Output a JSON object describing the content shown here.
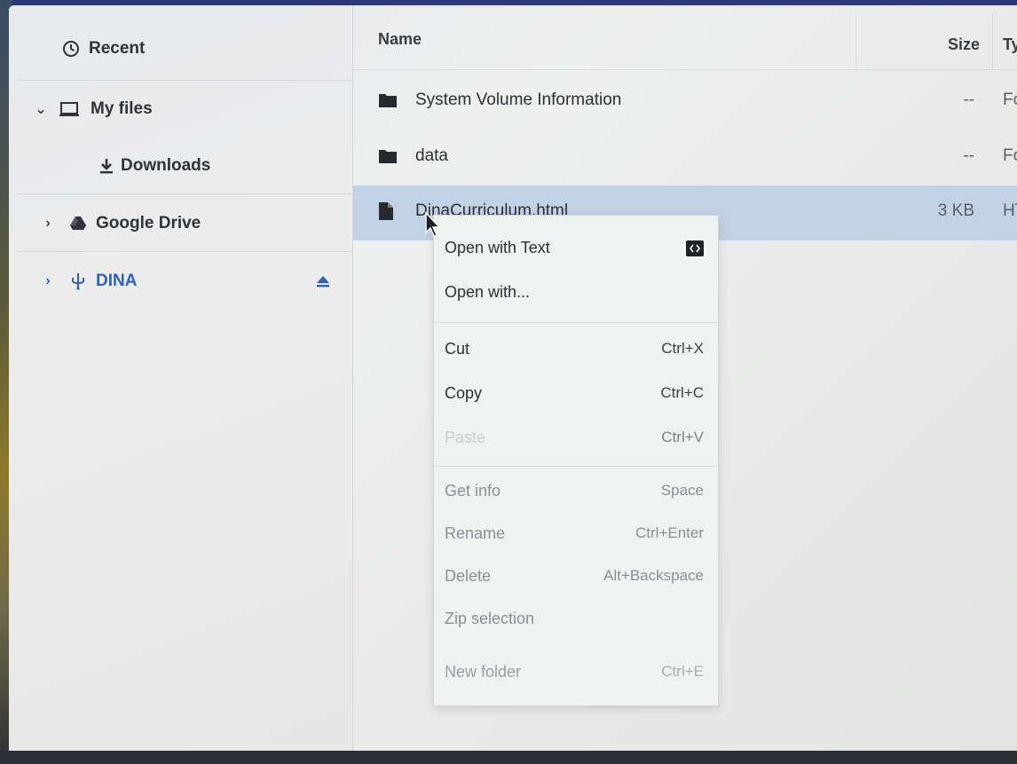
{
  "sidebar": {
    "items": [
      {
        "label": "Recent",
        "icon": "clock-icon"
      },
      {
        "label": "My files",
        "icon": "laptop-icon",
        "expanded": true
      },
      {
        "label": "Downloads",
        "icon": "download-icon"
      },
      {
        "label": "Google Drive",
        "icon": "google-drive-icon"
      },
      {
        "label": "DINA",
        "icon": "usb-icon",
        "action_icon": "eject-icon"
      }
    ]
  },
  "file_list": {
    "columns": {
      "name": "Name",
      "size": "Size",
      "type": "Ty"
    },
    "rows": [
      {
        "name": "System Volume Information",
        "size": "--",
        "type": "Fo",
        "icon": "folder-icon"
      },
      {
        "name": "data",
        "size": "--",
        "type": "Fo",
        "icon": "folder-icon"
      },
      {
        "name": "DinaCurriculum.html",
        "size": "3 KB",
        "type": "HT",
        "icon": "file-icon",
        "selected": true
      }
    ]
  },
  "context_menu": {
    "items": [
      {
        "label": "Open with Text",
        "shortcut": ""
      },
      {
        "label": "Open with...",
        "shortcut": ""
      },
      {
        "label": "Cut",
        "shortcut": "Ctrl+X"
      },
      {
        "label": "Copy",
        "shortcut": "Ctrl+C"
      },
      {
        "label": "Paste",
        "shortcut": "Ctrl+V",
        "disabled": true
      },
      {
        "label": "Get info",
        "shortcut": "Space"
      },
      {
        "label": "Rename",
        "shortcut": "Ctrl+Enter"
      },
      {
        "label": "Delete",
        "shortcut": "Alt+Backspace"
      },
      {
        "label": "Zip selection",
        "shortcut": ""
      },
      {
        "label": "New folder",
        "shortcut": "Ctrl+E",
        "disabled": true
      }
    ]
  },
  "colors": {
    "selection": "#c3d1e6",
    "accent_blue": "#2f5fbf"
  }
}
